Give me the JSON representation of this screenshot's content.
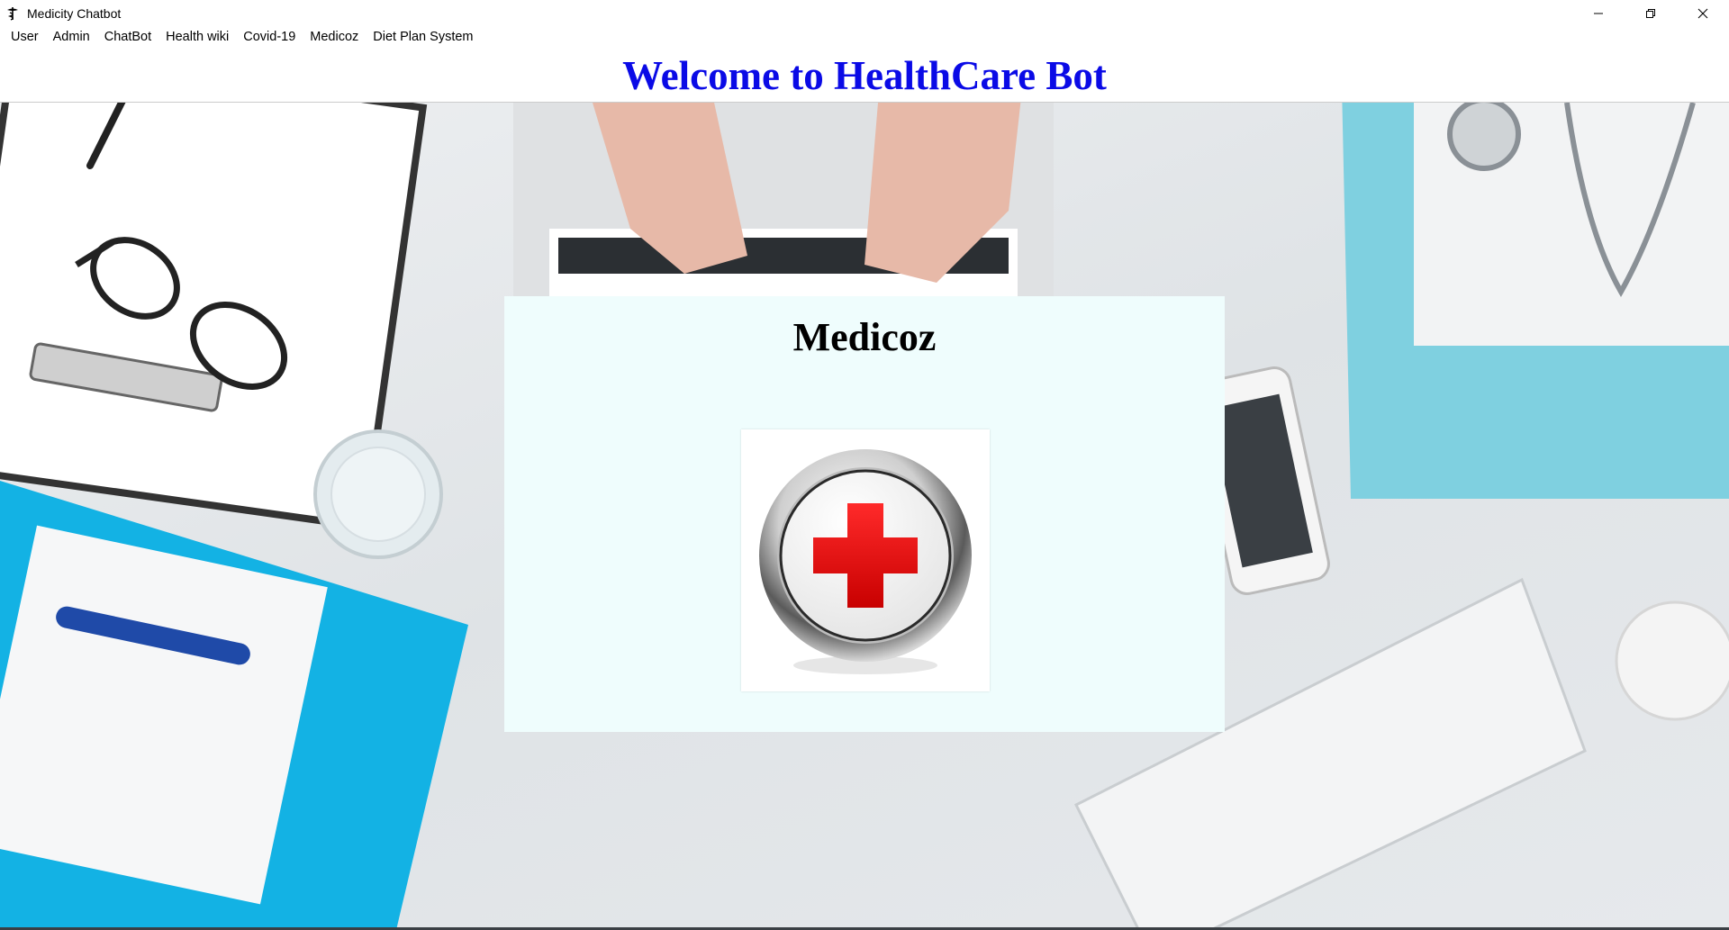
{
  "window": {
    "title": "Medicity Chatbot",
    "controls": [
      "minimize-icon",
      "restore-icon",
      "close-icon"
    ]
  },
  "menu": {
    "items": [
      {
        "label": "User"
      },
      {
        "label": "Admin"
      },
      {
        "label": "ChatBot"
      },
      {
        "label": "Health wiki"
      },
      {
        "label": "Covid-19"
      },
      {
        "label": "Medicoz"
      },
      {
        "label": "Diet Plan System"
      }
    ]
  },
  "banner": {
    "text": "Welcome to HealthCare Bot",
    "color": "#0a0ae6"
  },
  "panel": {
    "title": "Medicoz",
    "background": "#effdfd",
    "logo_icon": "red-cross-icon"
  },
  "colors": {
    "cross_red": "#e01010"
  }
}
